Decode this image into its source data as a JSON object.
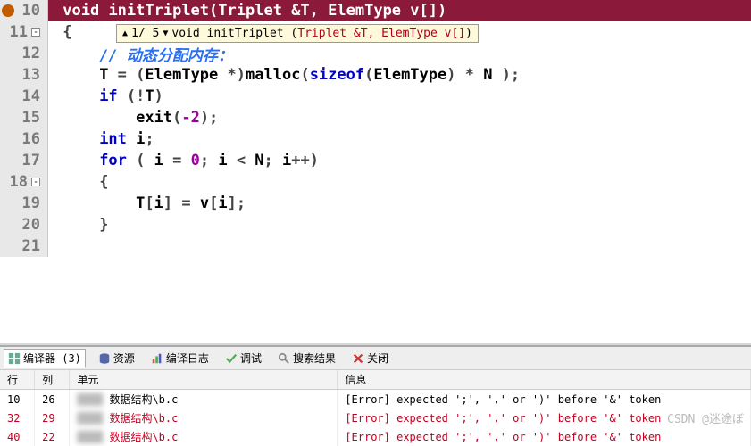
{
  "code": {
    "lines": [
      {
        "n": "10",
        "hl": true,
        "bp": true,
        "pre": " ",
        "tokens": [
          {
            "t": "void ",
            "c": "kw"
          },
          {
            "t": "initTriplet",
            "c": "id"
          },
          {
            "t": "(",
            "c": "p"
          },
          {
            "t": "Triplet ",
            "c": "id"
          },
          {
            "t": "&",
            "c": "p"
          },
          {
            "t": "T",
            "c": "id"
          },
          {
            "t": ", ",
            "c": "p"
          },
          {
            "t": "ElemType ",
            "c": "id"
          },
          {
            "t": "v",
            "c": "id"
          },
          {
            "t": "[])",
            "c": "p"
          }
        ]
      },
      {
        "n": "11",
        "fold": "-",
        "pre": " ",
        "tokens": [
          {
            "t": "{",
            "c": "p"
          }
        ]
      },
      {
        "n": "12",
        "pre": "     ",
        "tokens": [
          {
            "t": "// 动态分配内存：",
            "c": "cm"
          }
        ]
      },
      {
        "n": "13",
        "pre": "     ",
        "tokens": [
          {
            "t": "T ",
            "c": "id"
          },
          {
            "t": "= (",
            "c": "p"
          },
          {
            "t": "ElemType ",
            "c": "id"
          },
          {
            "t": "*",
            "c": "p"
          },
          {
            "t": ")",
            "c": "p"
          },
          {
            "t": "malloc",
            "c": "id"
          },
          {
            "t": "(",
            "c": "p"
          },
          {
            "t": "sizeof",
            "c": "kw"
          },
          {
            "t": "(",
            "c": "p"
          },
          {
            "t": "ElemType",
            "c": "id"
          },
          {
            "t": ") * ",
            "c": "p"
          },
          {
            "t": "N ",
            "c": "id"
          },
          {
            "t": ");",
            "c": "p"
          }
        ]
      },
      {
        "n": "14",
        "pre": "     ",
        "tokens": [
          {
            "t": "if ",
            "c": "kw"
          },
          {
            "t": "(!",
            "c": "p"
          },
          {
            "t": "T",
            "c": "id"
          },
          {
            "t": ")",
            "c": "p"
          }
        ]
      },
      {
        "n": "15",
        "pre": "         ",
        "tokens": [
          {
            "t": "exit",
            "c": "id"
          },
          {
            "t": "(",
            "c": "p"
          },
          {
            "t": "-2",
            "c": "num"
          },
          {
            "t": ");",
            "c": "p"
          }
        ]
      },
      {
        "n": "16",
        "pre": "     ",
        "tokens": [
          {
            "t": "int ",
            "c": "kw"
          },
          {
            "t": "i",
            "c": "id"
          },
          {
            "t": ";",
            "c": "p"
          }
        ]
      },
      {
        "n": "17",
        "pre": "     ",
        "tokens": [
          {
            "t": "for ",
            "c": "kw"
          },
          {
            "t": "( ",
            "c": "p"
          },
          {
            "t": "i ",
            "c": "id"
          },
          {
            "t": "= ",
            "c": "p"
          },
          {
            "t": "0",
            "c": "num"
          },
          {
            "t": "; ",
            "c": "p"
          },
          {
            "t": "i ",
            "c": "id"
          },
          {
            "t": "< ",
            "c": "p"
          },
          {
            "t": "N",
            "c": "id"
          },
          {
            "t": "; ",
            "c": "p"
          },
          {
            "t": "i",
            "c": "id"
          },
          {
            "t": "++)",
            "c": "p"
          }
        ]
      },
      {
        "n": "18",
        "fold": "-",
        "pre": "     ",
        "tokens": [
          {
            "t": "{",
            "c": "p"
          }
        ]
      },
      {
        "n": "19",
        "pre": "         ",
        "tokens": [
          {
            "t": "T",
            "c": "id"
          },
          {
            "t": "[",
            "c": "p"
          },
          {
            "t": "i",
            "c": "id"
          },
          {
            "t": "] = ",
            "c": "p"
          },
          {
            "t": "v",
            "c": "id"
          },
          {
            "t": "[",
            "c": "p"
          },
          {
            "t": "i",
            "c": "id"
          },
          {
            "t": "];",
            "c": "p"
          }
        ]
      },
      {
        "n": "20",
        "pre": "     ",
        "tokens": [
          {
            "t": "}",
            "c": "p"
          }
        ]
      },
      {
        "n": "21",
        "pre": " ",
        "tokens": []
      }
    ]
  },
  "tooltip": {
    "nav": "1/ 5",
    "nav_icons": {
      "up": "▲",
      "down": "▼"
    },
    "sig_prefix": "void initTriplet (",
    "sig_params": "Triplet &T, ElemType v[]",
    "sig_suffix": ")"
  },
  "tabs": [
    {
      "label": "编译器 (3)",
      "icon": "grid",
      "active": true
    },
    {
      "label": "资源",
      "icon": "db"
    },
    {
      "label": "编译日志",
      "icon": "bars"
    },
    {
      "label": "调试",
      "icon": "check"
    },
    {
      "label": "搜索结果",
      "icon": "search"
    },
    {
      "label": "关闭",
      "icon": "close"
    }
  ],
  "columns": {
    "line": "行",
    "col": "列",
    "unit": "单元",
    "info": "信息"
  },
  "errors": [
    {
      "line": "10",
      "col": "26",
      "unit": "数据结构\\b.c",
      "info": "[Error] expected ';', ',' or ')' before '&' token",
      "err": false
    },
    {
      "line": "32",
      "col": "29",
      "unit": "数据结构\\b.c",
      "info": "[Error] expected ';', ',' or ')' before '&' token",
      "err": true
    },
    {
      "line": "40",
      "col": "22",
      "unit": "数据结构\\b.c",
      "info": "[Error] expected ';', ',' or ')' before '&' token",
      "err": true
    }
  ],
  "watermark": "CSDN @迷途ぼ"
}
